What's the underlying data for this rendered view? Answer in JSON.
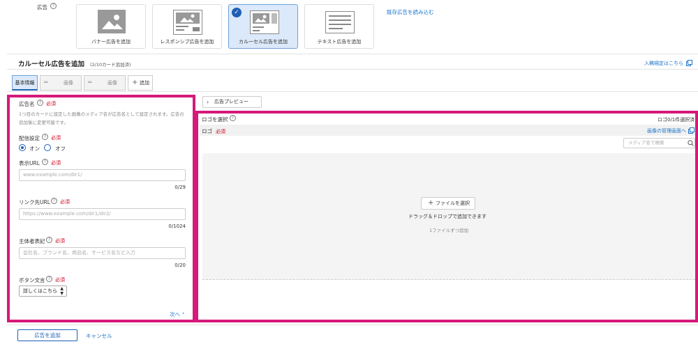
{
  "ad_type_section": {
    "label": "広告",
    "cards": [
      {
        "label": "バナー広告を追加"
      },
      {
        "label": "レスポンシブ広告を追加"
      },
      {
        "label": "カルーセル広告を追加"
      },
      {
        "label": "テキスト広告を追加"
      }
    ],
    "load_existing": "既存広告を読み込む"
  },
  "header": {
    "title": "カルーセル広告を追加",
    "count": "(2/10カード追加済)",
    "entry_rule_link": "入稿規定はこちら"
  },
  "tabs": [
    {
      "label": "基本情報"
    },
    {
      "label": "画像"
    },
    {
      "label": "画像"
    },
    {
      "label": "追加"
    }
  ],
  "form": {
    "ad_name": {
      "label": "広告名",
      "required": "必須",
      "description": "1つ目のカードに設定した画像のメディア名が広告名として設定されます。広告の追加後に変更可能です。"
    },
    "delivery": {
      "label": "配信設定",
      "required": "必須",
      "on_label": "オン",
      "off_label": "オフ"
    },
    "display_url": {
      "label": "表示URL",
      "required": "必須",
      "placeholder": "www.example.com/dir1/",
      "counter": "0/29"
    },
    "link_url": {
      "label": "リンク先URL",
      "required": "必須",
      "placeholder": "https://www.example.com/dir1/dir2/",
      "counter": "0/1024"
    },
    "principal": {
      "label": "主体者表記",
      "required": "必須",
      "placeholder": "会社名、ブランド名、商品名、サービス名など入力",
      "counter": "0/20"
    },
    "button_text": {
      "label": "ボタン文言",
      "required": "必須",
      "value": "詳しくはこちら"
    },
    "next": "次へ"
  },
  "right_panel": {
    "preview_button": "広告プレビュー",
    "logo_select": "ロゴを選択",
    "logo_count": "ロゴ0/1件選択済",
    "logo_label": "ロゴ",
    "required": "必須",
    "image_manage_link": "画像の管理画面へ",
    "search_placeholder": "メディア名で検索",
    "select_file": "ファイルを選択",
    "drop_text": "ドラッグ＆ドロップで追加できます",
    "one_file": "1ファイルずつ追加"
  },
  "footer": {
    "add_button": "広告を追加",
    "cancel": "キャンセル"
  },
  "colors": {
    "accent": "#1e5fb4",
    "highlight": "#d6197a",
    "required": "#d0021b"
  }
}
